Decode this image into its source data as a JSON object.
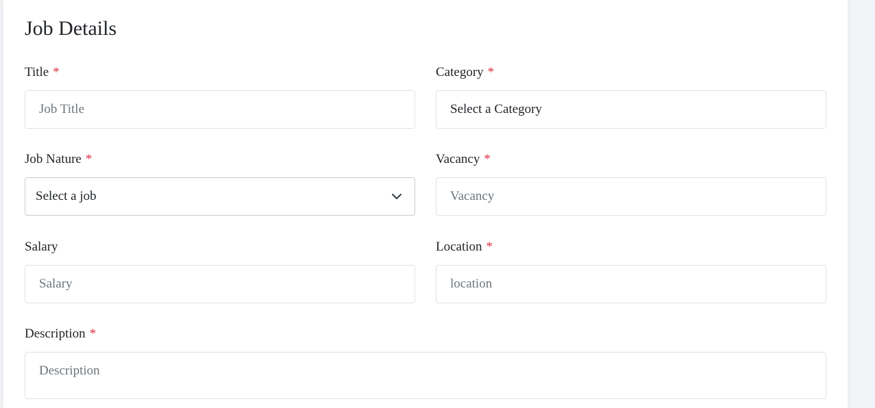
{
  "form": {
    "heading": "Job Details",
    "title": {
      "label": "Title",
      "required_mark": "*",
      "placeholder": "Job Title"
    },
    "category": {
      "label": "Category",
      "required_mark": "*",
      "selected": "Select a Category"
    },
    "job_nature": {
      "label": "Job Nature",
      "required_mark": "*",
      "selected": "Select a job",
      "icon": "chevron-down-icon"
    },
    "vacancy": {
      "label": "Vacancy",
      "required_mark": "*",
      "placeholder": "Vacancy"
    },
    "salary": {
      "label": "Salary",
      "placeholder": "Salary"
    },
    "location": {
      "label": "Location",
      "required_mark": "*",
      "placeholder": "location"
    },
    "description": {
      "label": "Description",
      "required_mark": "*",
      "placeholder": "Description"
    }
  },
  "colors": {
    "required": "#dc3545",
    "border": "#dee2e6",
    "placeholder": "#6c757d",
    "background": "#f3f4f7"
  }
}
